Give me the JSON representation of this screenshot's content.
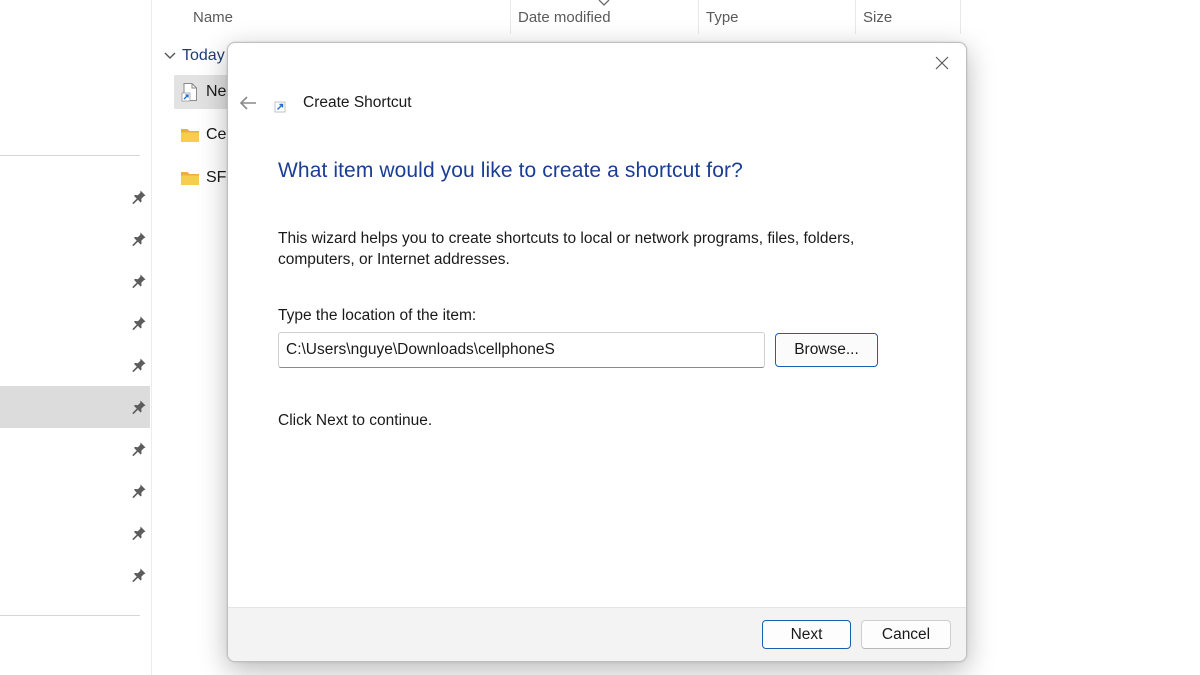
{
  "explorer": {
    "columns": {
      "name": "Name",
      "date_modified": "Date modified",
      "type": "Type",
      "size": "Size"
    },
    "group": {
      "label": "Today"
    },
    "files": [
      {
        "name": "Ne",
        "icon": "shortcut-file-icon",
        "selected": true
      },
      {
        "name": "Cel",
        "icon": "folder-icon"
      },
      {
        "name": "SF",
        "icon": "folder-icon"
      }
    ],
    "quick_access_pins": 10,
    "selected_pin_index": 5
  },
  "dialog": {
    "title": "Create Shortcut",
    "heading": "What item would you like to create a shortcut for?",
    "description": "This wizard helps you to create shortcuts to local or network programs, files, folders, computers, or Internet addresses.",
    "location_label": "Type the location of the item:",
    "location_value": "C:\\Users\\nguye\\Downloads\\cellphoneS",
    "browse_label": "Browse...",
    "hint": "Click Next to continue.",
    "next_label": "Next",
    "cancel_label": "Cancel"
  },
  "colors": {
    "heading": "#1a3e93",
    "accent_border": "#1a5fb4",
    "footer_bg": "#f3f3f3",
    "selected_row": "#dcdcdc"
  }
}
